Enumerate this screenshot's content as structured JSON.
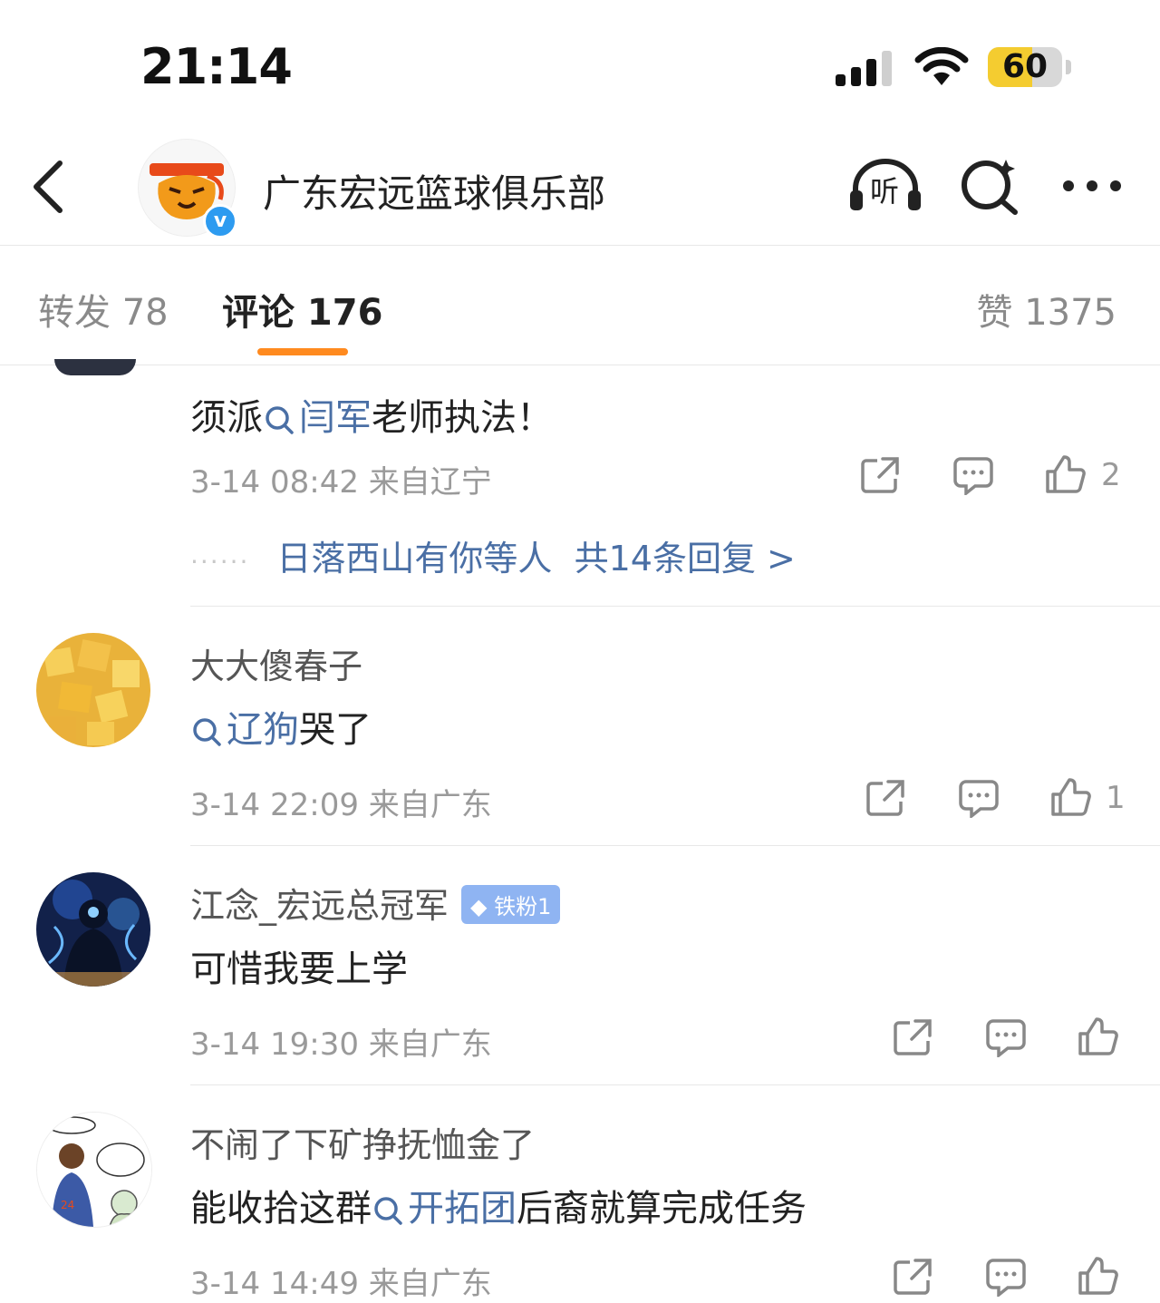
{
  "status_bar": {
    "time": "21:14",
    "battery_level": "60",
    "battery_fraction": 0.6
  },
  "header": {
    "title": "广东宏远篮球俱乐部",
    "listen_label": "听"
  },
  "tabs": {
    "repost": "转发 78",
    "comment": "评论 176",
    "like": "赞 1375"
  },
  "comments": [
    {
      "text_prefix": "须派",
      "topic": "闫军",
      "text_suffix": "老师执法！",
      "meta": "3-14 08:42  来自辽宁",
      "likes": "2",
      "reply_user": "日落西山有你等人",
      "reply_count": "共14条回复 >"
    },
    {
      "name": "大大傻春子",
      "topic": "辽狗",
      "text_suffix": "哭了",
      "meta": "3-14 22:09  来自广东",
      "likes": "1"
    },
    {
      "name": "江念_宏远总冠军",
      "badge": "铁粉1",
      "text": "可惜我要上学",
      "meta": "3-14 19:30  来自广东"
    },
    {
      "name": "不闹了下矿挣抚恤金了",
      "text_prefix": "能收拾这群",
      "topic": "开拓团",
      "text_suffix": "后裔就算完成任务",
      "meta": "3-14 14:49  来自广东"
    }
  ]
}
